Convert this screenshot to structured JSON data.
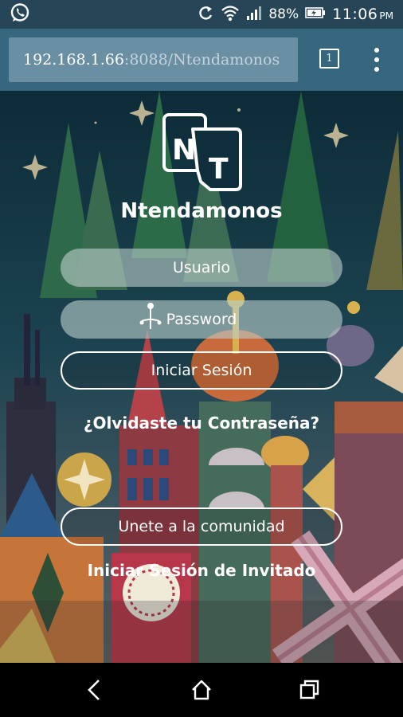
{
  "status_bar": {
    "battery": "88%",
    "time": "11:06",
    "ampm": "PM",
    "icons": [
      "whatsapp-icon",
      "sync-icon",
      "wifi-icon",
      "signal-icon",
      "battery-charging-icon"
    ]
  },
  "browser": {
    "url_host": "192.168.1.66",
    "url_path": ":8088/Ntendamonos",
    "tab_count": "1"
  },
  "app": {
    "logo_letters": "NT",
    "brand_name": "Ntendamonos",
    "username_placeholder": "Usuario",
    "password_placeholder": "Password",
    "login_button": "Iniciar Sesión",
    "forgot_password": "¿Olvidaste tu Contraseña?",
    "join_button": "Unete a la comunidad",
    "guest_login": "Iniciar Sesión de Invitado"
  },
  "colors": {
    "status_bar": "#264658",
    "url_bar": "#37667f",
    "url_field": "#6a8fa3",
    "background_top": "#0f2f3c"
  },
  "nav_bar": {
    "icons": [
      "back-icon",
      "home-icon",
      "recents-icon"
    ]
  }
}
